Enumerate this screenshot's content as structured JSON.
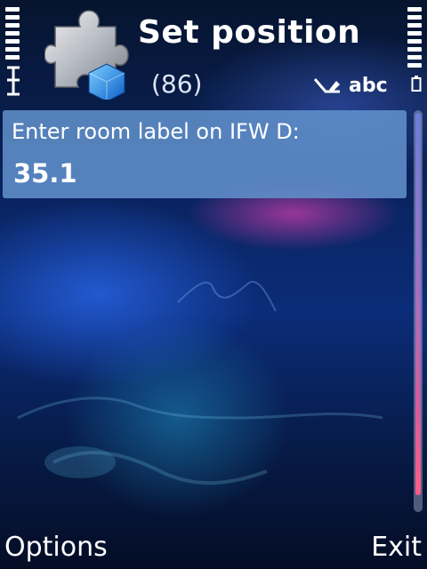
{
  "header": {
    "title": "Set position",
    "counter": "(86)",
    "input_mode": "abc",
    "app_icon": "puzzle-piece-icon"
  },
  "status": {
    "signal_icon": "signal-strength-icon",
    "battery_icon": "battery-level-icon",
    "input_mode_icon": "pen-input-icon"
  },
  "query": {
    "prompt": "Enter room label on IFW D:",
    "value": "35.1"
  },
  "softkeys": {
    "left": "Options",
    "right": "Exit"
  },
  "colors": {
    "panel": "#6292cd",
    "scrollbar_accent": "#ff5c86"
  }
}
